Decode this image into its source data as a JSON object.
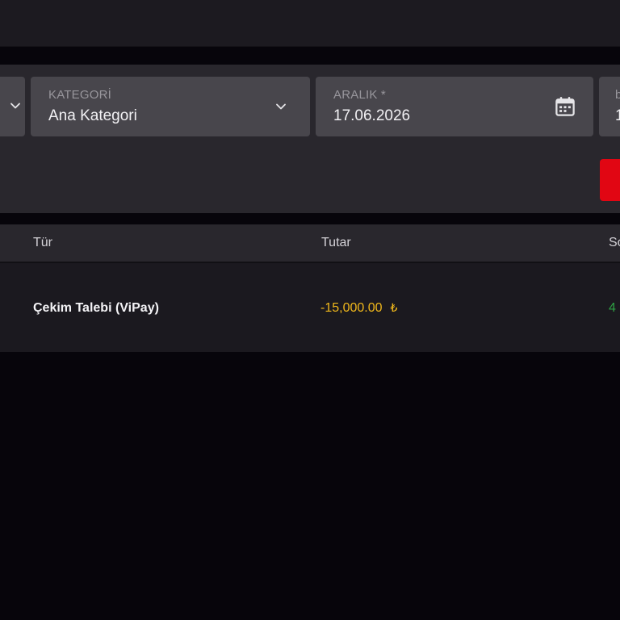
{
  "filters": {
    "partial_left": {
      "icon": "chevron-down-icon"
    },
    "category": {
      "label": "KATEGORİ",
      "value": "Ana Kategori",
      "icon": "chevron-down-icon"
    },
    "date_range": {
      "label": "ARALIK *",
      "value": "17.06.2026",
      "icon": "calendar-icon"
    },
    "partial_right": {
      "label": "b",
      "value": "1"
    },
    "search_button_color": "#e10613"
  },
  "table": {
    "headers": {
      "type": "Tür",
      "amount": "Tutar",
      "status": "So"
    },
    "rows": [
      {
        "type": "Çekim Talebi (ViPay)",
        "amount": "-15,000.00",
        "currency": "₺",
        "status": "4"
      }
    ]
  },
  "colors": {
    "background": "#07050b",
    "panel": "#29272d",
    "field": "#48464c",
    "amount_negative": "#f1b81b",
    "status_green": "#2ea043",
    "accent_red": "#e10613"
  }
}
